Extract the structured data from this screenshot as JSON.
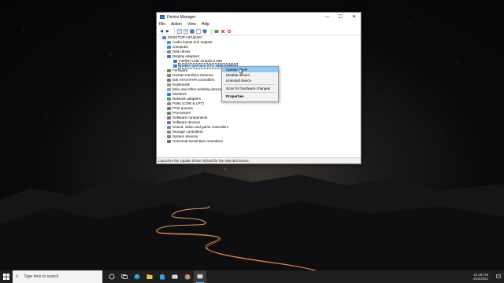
{
  "window": {
    "title": "Device Manager",
    "controls": {
      "minimize": "—",
      "maximize": "☐",
      "close": "✕"
    },
    "menu": [
      "File",
      "Action",
      "View",
      "Help"
    ],
    "status": "Launches the Update Driver Wizard for the selected device."
  },
  "tree": {
    "root": "DESKTOP-HPUE2IO",
    "items": [
      {
        "label": "Audio inputs and outputs",
        "icon": "speaker-icon"
      },
      {
        "label": "Computer",
        "icon": "computer-icon"
      },
      {
        "label": "Disk drives",
        "icon": "disk-icon"
      },
      {
        "label": "Display adapters",
        "icon": "monitor-icon",
        "expanded": true,
        "children": [
          {
            "label": "Intel(R) UHD Graphics 630"
          },
          {
            "label": "NVIDIA GeForce GTX 1660 SUPER",
            "selected": true
          }
        ]
      },
      {
        "label": "Firmware",
        "icon": "chip-icon"
      },
      {
        "label": "Human Interface Devices",
        "icon": "hid-icon"
      },
      {
        "label": "IDE ATA/ATAPI controllers",
        "icon": "controller-icon"
      },
      {
        "label": "Keyboards",
        "icon": "keyboard-icon"
      },
      {
        "label": "Mice and other pointing devices",
        "icon": "mouse-icon"
      },
      {
        "label": "Monitors",
        "icon": "monitor-icon"
      },
      {
        "label": "Network adapters",
        "icon": "network-icon"
      },
      {
        "label": "Ports (COM & LPT)",
        "icon": "port-icon"
      },
      {
        "label": "Print queues",
        "icon": "printer-icon"
      },
      {
        "label": "Processors",
        "icon": "cpu-icon"
      },
      {
        "label": "Software components",
        "icon": "component-icon"
      },
      {
        "label": "Software devices",
        "icon": "component-icon"
      },
      {
        "label": "Sound, video and game controllers",
        "icon": "speaker-icon"
      },
      {
        "label": "Storage controllers",
        "icon": "storage-icon"
      },
      {
        "label": "System devices",
        "icon": "system-icon"
      },
      {
        "label": "Universal Serial Bus controllers",
        "icon": "usb-icon"
      }
    ]
  },
  "context_menu": {
    "update": "Update driver",
    "disable": "Disable device",
    "uninstall": "Uninstall device",
    "scan": "Scan for hardware changes",
    "properties": "Properties"
  },
  "taskbar": {
    "search_placeholder": "Type here to search",
    "time": "12:49 AM",
    "date": "4/16/2021"
  },
  "colors": {
    "selection": "#cce8ff",
    "menu_highlight": "#91c9f7",
    "taskbar": "#1f1f1f"
  }
}
